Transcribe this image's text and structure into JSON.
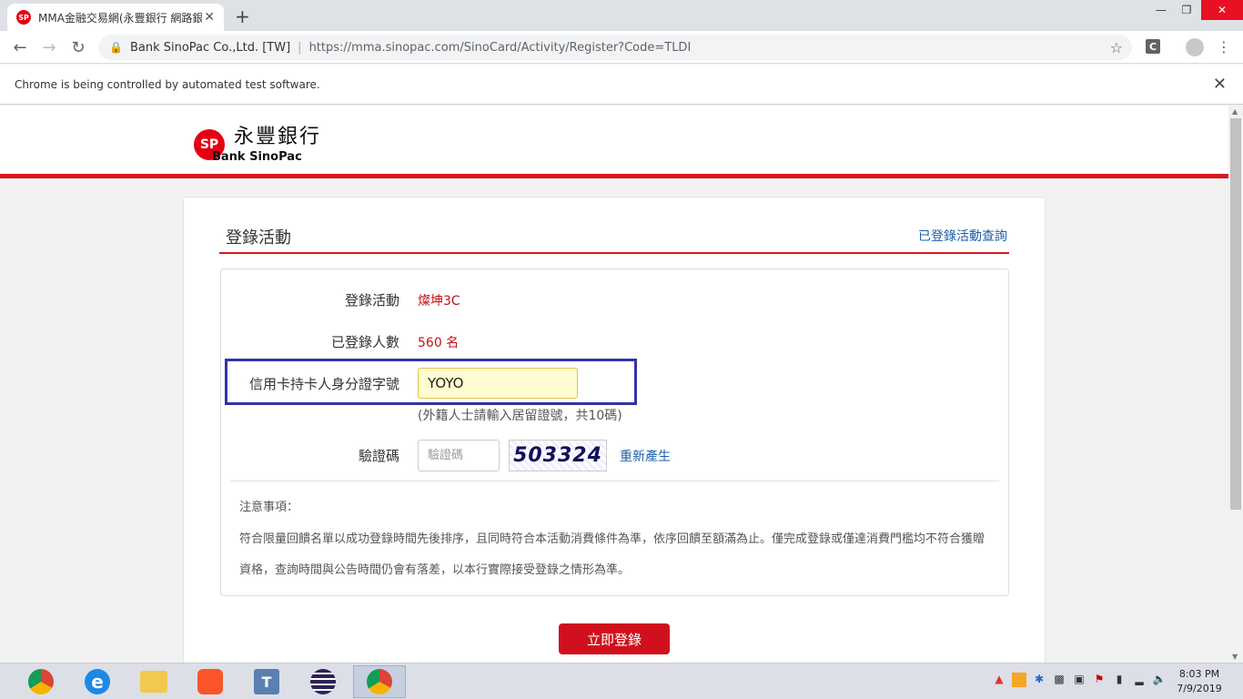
{
  "browser": {
    "tab_title": "MMA金融交易網(永豐銀行 網路銀",
    "tab_close": "✕",
    "new_tab": "+",
    "org": "Bank SinoPac Co.,Ltd. [TW]",
    "url": "https://mma.sinopac.com/SinoCard/Activity/Register?Code=TLDI",
    "ext_label": "C",
    "infobar_text": "Chrome is being controlled by automated test software."
  },
  "header": {
    "logo_mark": "SP",
    "logo_cn": "永豐銀行",
    "logo_en": "Bank SinoPac"
  },
  "card": {
    "title": "登錄活動",
    "query_link": "已登錄活動查詢",
    "rows": {
      "activity_label": "登錄活動",
      "activity_value": "燦坤3C",
      "count_label": "已登錄人數",
      "count_value": "560 名",
      "id_label": "信用卡持卡人身分證字號",
      "id_value": "YOYO",
      "id_hint": "(外籍人士請輸入居留證號，共10碼)",
      "captcha_label": "驗證碼",
      "captcha_placeholder": "驗證碼",
      "captcha_image_text": "503324",
      "regen_link": "重新產生"
    },
    "notes": {
      "title": "注意事項：",
      "text": "符合限量回饋名單以成功登錄時間先後排序，且同時符合本活動消費條件為準，依序回饋至額滿為止。僅完成登錄或僅達消費門檻均不符合獲贈資格，查詢時間與公告時間仍會有落差，以本行實際接受登錄之情形為準。"
    },
    "submit_label": "立即登錄"
  },
  "taskbar": {
    "apps": [
      "chrome-icon",
      "internet-explorer-icon",
      "file-explorer-icon",
      "brave-icon",
      "typing-tool-icon",
      "eclipse-icon",
      "chrome-icon"
    ],
    "clock_time": "8:03 PM",
    "clock_date": "7/9/2019"
  },
  "colors": {
    "brand_red": "#d71920",
    "link_blue": "#1a5ea8",
    "highlight_box": "#3333aa"
  }
}
